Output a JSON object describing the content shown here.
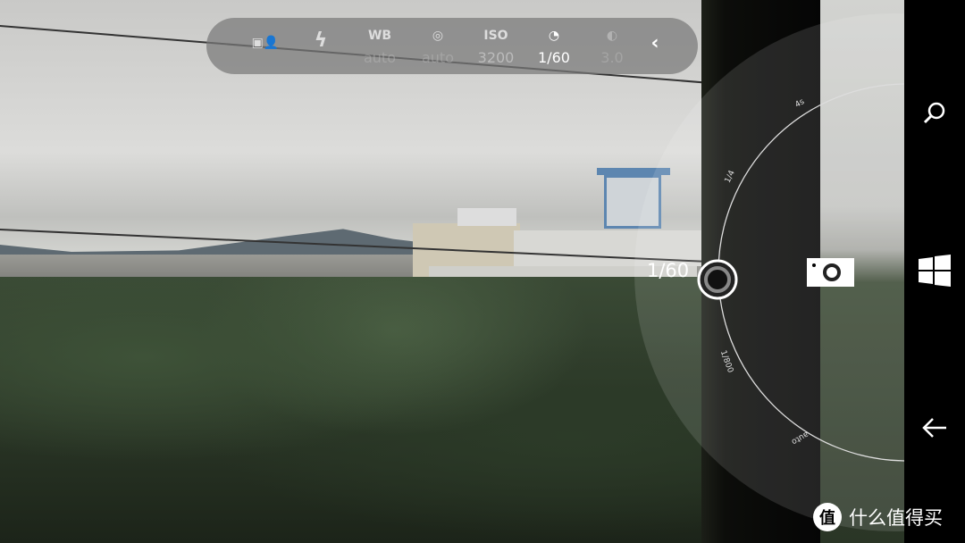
{
  "toolbar": {
    "items": [
      {
        "icon": "scene-mode-icon",
        "label": "",
        "value": ""
      },
      {
        "icon": "flash-icon",
        "label": "",
        "value": ""
      },
      {
        "icon": "",
        "label": "WB",
        "value": "auto"
      },
      {
        "icon": "focus-icon",
        "label": "",
        "value": "auto"
      },
      {
        "icon": "",
        "label": "ISO",
        "value": "3200"
      },
      {
        "icon": "shutter-speed-icon",
        "label": "",
        "value": "1/60"
      },
      {
        "icon": "exposure-icon",
        "label": "",
        "value": "3.0"
      }
    ],
    "collapse_icon": "chevron-left-icon"
  },
  "dial": {
    "current": "1/60",
    "ticks": [
      "4s",
      "1/4",
      "1/800",
      "auto"
    ]
  },
  "nav": {
    "search": "search-icon",
    "start": "windows-icon",
    "back": "back-arrow-icon"
  },
  "camera_button": "camera-icon",
  "watermark": {
    "badge": "值",
    "text": "什么值得买"
  },
  "colors": {
    "toolbar_bg": "#787878",
    "active": "#ffffff",
    "inactive": "#bbbbbb"
  }
}
